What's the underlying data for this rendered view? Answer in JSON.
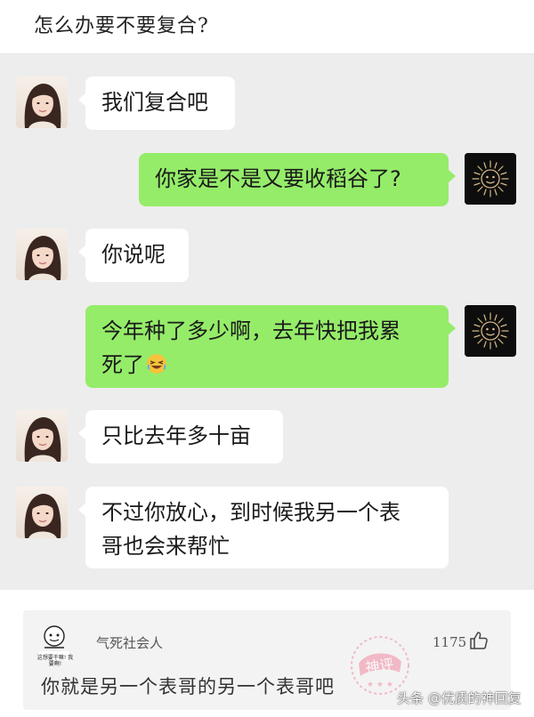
{
  "header": {
    "title": "怎么办要不要复合?"
  },
  "messages": [
    {
      "side": "left",
      "text": "我们复合吧"
    },
    {
      "side": "right",
      "text": "你家是不是又要收稻谷了?"
    },
    {
      "side": "left",
      "text": "你说呢"
    },
    {
      "side": "right",
      "line1": "今年种了多少啊，去年快把我累",
      "line2": "死了",
      "emoji": "rolling-laughing-emoji"
    },
    {
      "side": "left",
      "text": "只比去年多十亩"
    },
    {
      "side": "left",
      "line1": "不过你放心，到时候我另一个表",
      "line2": "哥也会来帮忙"
    }
  ],
  "comment": {
    "avatar_caption": "这想要干嘛! 我要啊!",
    "username": "气死社会人",
    "like_count": "1175",
    "text": "你就是另一个表哥的另一个表哥吧",
    "stamp_text": "神评",
    "stamp_color": "#f08aa0"
  },
  "watermark": "头条 @优质的神回复",
  "colors": {
    "bubble_green": "#95ec69",
    "bubble_white": "#ffffff",
    "chat_bg": "#ededed"
  }
}
